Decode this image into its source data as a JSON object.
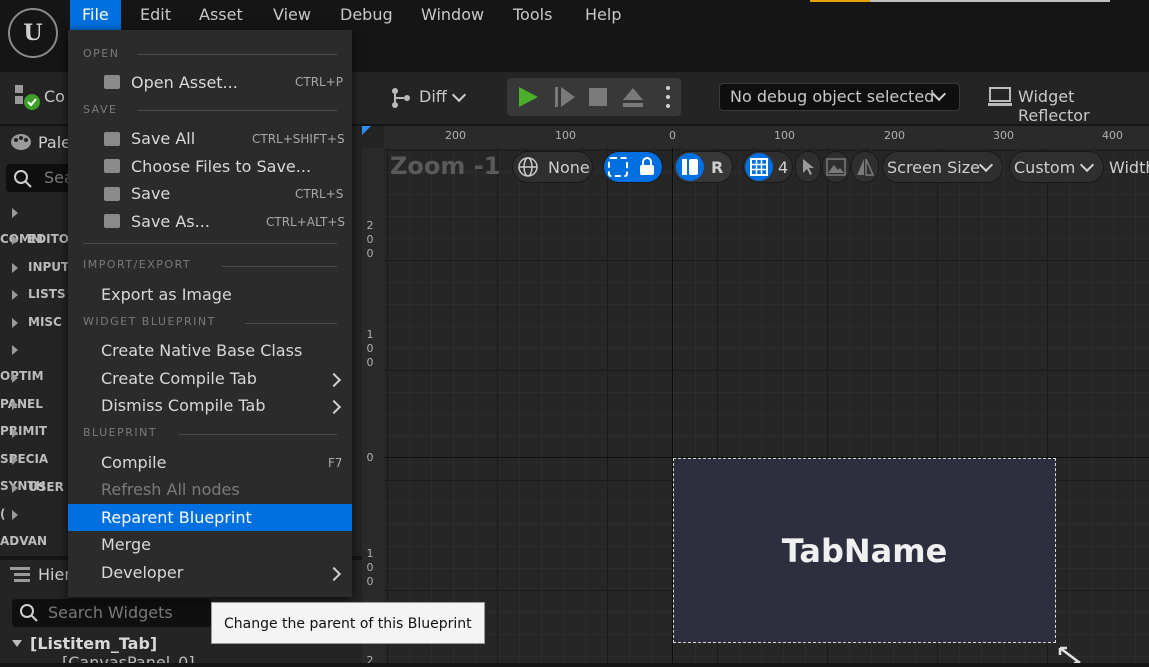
{
  "menubar": {
    "items": [
      "File",
      "Edit",
      "Asset",
      "View",
      "Debug",
      "Window",
      "Tools",
      "Help"
    ],
    "active": "File"
  },
  "toolbar": {
    "compile_partial": "Co",
    "diff_label": "Diff",
    "debug_select": "No debug object selected",
    "widget_reflector": "Widget Reflector"
  },
  "palette": {
    "title_partial": "Pale",
    "search_partial": "Sea",
    "categories": [
      "COMM",
      "EDITO",
      "INPUT",
      "LISTS",
      "MISC",
      "OPTIM",
      "PANEL",
      "PRIMIT",
      "SPECIA",
      "SYNTH",
      "USER (",
      "ADVAN"
    ]
  },
  "hierarchy": {
    "title_partial": "Hier",
    "search_placeholder": "Search Widgets",
    "root": "[Listitem_Tab]",
    "child_partial": "[CanvasPanel_0]"
  },
  "designer": {
    "zoom": "Zoom -1",
    "ruler_top": [
      "200",
      "100",
      "0",
      "100",
      "200",
      "300",
      "400"
    ],
    "ruler_left": [
      "200",
      "100",
      "0",
      "100",
      "2"
    ],
    "localization": "None",
    "r_label": "R",
    "grid_snap": "4",
    "screen_size": "Screen Size",
    "custom": "Custom",
    "width_partial": "Width",
    "widget_text": "TabName"
  },
  "file_menu": {
    "sections": {
      "open": "OPEN",
      "save": "SAVE",
      "import_export": "IMPORT/EXPORT",
      "widget_blueprint": "WIDGET BLUEPRINT",
      "blueprint": "BLUEPRINT"
    },
    "items": {
      "open_asset": {
        "label": "Open Asset...",
        "shortcut": "CTRL+P"
      },
      "save_all": {
        "label": "Save All",
        "shortcut": "CTRL+SHIFT+S"
      },
      "choose_files": {
        "label": "Choose Files to Save..."
      },
      "save": {
        "label": "Save",
        "shortcut": "CTRL+S"
      },
      "save_as": {
        "label": "Save As...",
        "shortcut": "CTRL+ALT+S"
      },
      "export_image": {
        "label": "Export as Image"
      },
      "create_native": {
        "label": "Create Native Base Class"
      },
      "create_compile_tab": {
        "label": "Create Compile Tab"
      },
      "dismiss_compile_tab": {
        "label": "Dismiss Compile Tab"
      },
      "compile": {
        "label": "Compile",
        "shortcut": "F7"
      },
      "refresh_nodes": {
        "label": "Refresh All nodes"
      },
      "reparent": {
        "label": "Reparent Blueprint"
      },
      "merge": {
        "label": "Merge"
      },
      "developer": {
        "label": "Developer"
      }
    }
  },
  "tooltip": "Change the parent of this Blueprint",
  "colors": {
    "accent": "#0070e0",
    "play_green": "#4caf2a",
    "panel": "#242424"
  }
}
